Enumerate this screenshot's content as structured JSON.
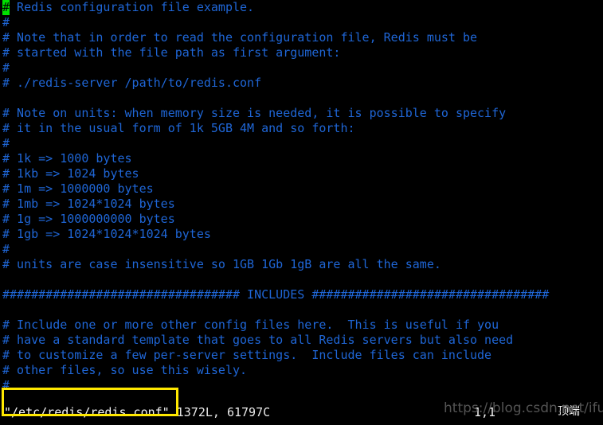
{
  "app": {
    "name": "vim",
    "title": "Redis configuration file example."
  },
  "colors": {
    "background": "#000000",
    "comment_blue": "#1f66d6",
    "cursor_green": "#00e000",
    "cursor_text": "#000000",
    "status_text": "#e8e8e8",
    "annotation_yellow": "#ffe800",
    "watermark_gray": "#5b5b5b"
  },
  "editor": {
    "cursor": {
      "char": "#",
      "line": 1,
      "column": 1
    },
    "lines": [
      "# Redis configuration file example.",
      "#",
      "# Note that in order to read the configuration file, Redis must be",
      "# started with the file path as first argument:",
      "#",
      "# ./redis-server /path/to/redis.conf",
      "",
      "# Note on units: when memory size is needed, it is possible to specify",
      "# it in the usual form of 1k 5GB 4M and so forth:",
      "#",
      "# 1k => 1000 bytes",
      "# 1kb => 1024 bytes",
      "# 1m => 1000000 bytes",
      "# 1mb => 1024*1024 bytes",
      "# 1g => 1000000000 bytes",
      "# 1gb => 1024*1024*1024 bytes",
      "#",
      "# units are case insensitive so 1GB 1Gb 1gB are all the same.",
      "",
      "################################# INCLUDES #################################",
      "",
      "# Include one or more other config files here.  This is useful if you",
      "# have a standard template that goes to all Redis servers but also need",
      "# to customize a few per-server settings.  Include files can include",
      "# other files, so use this wisely.",
      "#"
    ],
    "first_line_rest": " Redis configuration file example."
  },
  "status": {
    "filename": "\"/etc/redis/redis.conf\"",
    "file_info": "1372L, 61797C",
    "ruler": "1,1",
    "position_label": "顶端"
  },
  "annotation": {
    "type": "highlight-rectangle",
    "target": "\"/etc/redis/redis.conf\"",
    "color": "#ffe800"
  },
  "watermark": {
    "text": "https://blog.csdn.net/ifubing"
  }
}
